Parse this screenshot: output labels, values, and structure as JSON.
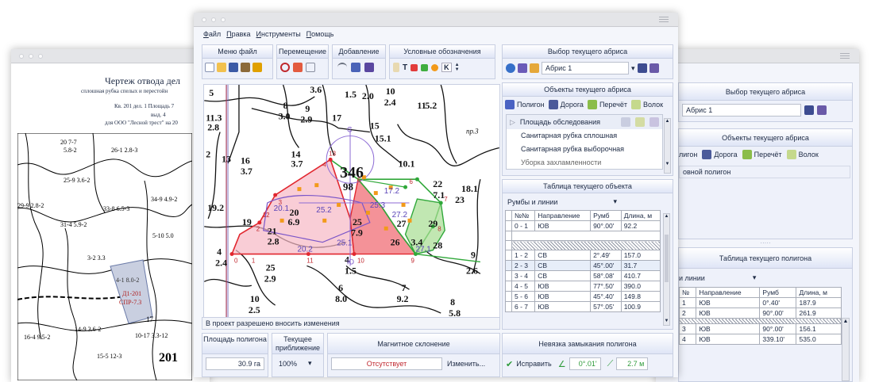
{
  "left_doc": {
    "title": "Чертеж отвода дел",
    "subtitle": "сплошная рубка спелых и перестойн",
    "line3": "Кв. 201  дел. 1  Площадь  7",
    "line4": "выд. 4",
    "line5": "для ООО \"Лесной трест\" на 20",
    "map_labels": [
      "20 7-7",
      "5.8-2",
      "26-1 2.8-3",
      "25-9 3.6-2",
      "33-8 6.5-3",
      "34-9 4.9-2",
      "29-9 2.8-2",
      "31-4 5.9-2",
      "5-10 5.0",
      "4-1 8.0-2",
      "Д1-201",
      "СПР-7.3",
      "3-2 3.3",
      "14-9 3.6-2",
      "16-4 9.5-2",
      "15-5 12-3",
      "201",
      "10-17 3.3-12",
      "17"
    ]
  },
  "main": {
    "menu": [
      {
        "label": "Файл",
        "key": "Ф",
        "rest": "айл"
      },
      {
        "label": "Правка",
        "key": "П",
        "rest": "равка"
      },
      {
        "label": "Инструменты",
        "key": "И",
        "rest": "нструменты"
      },
      {
        "label": "Помощь",
        "key": "П",
        "rest": "омощь"
      }
    ],
    "toolbar_groups": {
      "file": "Меню файл",
      "move": "Перемещение",
      "add": "Добавление",
      "legend": "Условные обозначения"
    },
    "legend_letters": {
      "t": "T",
      "k": "K"
    },
    "map": {
      "big_number": "346",
      "big_sub": "98",
      "numbers": [
        "5",
        "11.3",
        "2.8",
        "2",
        "13",
        "16",
        "3.7",
        "19.2",
        "4",
        "2.4",
        "19",
        "21",
        "2.8",
        "20",
        "6.9",
        "25",
        "7.9",
        "26",
        "3.4",
        "27",
        "28",
        "29",
        "22",
        "7.1",
        "23",
        "18.1",
        "10.1",
        "14",
        "3.7",
        "17",
        "8",
        "3.0",
        "9",
        "2.9",
        "1.5",
        "2.0",
        "10",
        "2.4",
        "11",
        "5.2",
        "15",
        "15.1",
        "пр.3",
        "4",
        "1.5",
        "2",
        "5",
        "2.9",
        "6",
        "8.0",
        "7",
        "9.2",
        "8",
        "5.8",
        "9",
        "2.6",
        "10",
        "2.5",
        "3.6"
      ],
      "distances": [
        "20.1",
        "25.2",
        "17.2",
        "25.3",
        "27.2",
        "27.1",
        "25.1",
        "20.2"
      ],
      "vertex_labels": [
        "0",
        "1",
        "2",
        "3",
        "4",
        "5",
        "6",
        "7",
        "8",
        "9",
        "10",
        "11",
        "12",
        "13"
      ],
      "compass": "С",
      "south": "Ю"
    },
    "status": "В проект разрешено вносить изменения",
    "bottom": {
      "area_label": "Площадь полигона",
      "area_value": "30.9 га",
      "zoom_label": "Текущее приближение",
      "zoom_value": "100%",
      "magnetic_label": "Магнитное склонение",
      "magnetic_value": "Отсутствует",
      "change_button": "Изменить...",
      "closure_label": "Невязка замыкания полигона",
      "fix_button": "Исправить",
      "angle_value": "0°.01'",
      "length_value": "2.7 м"
    }
  },
  "right_panel": {
    "abris_header": "Выбор текущего абриса",
    "abris_value": "Абрис 1",
    "objects_header": "Объекты текущего абриса",
    "object_buttons": [
      "Полигон",
      "Дорога",
      "Перечёт",
      "Волок"
    ],
    "objects_list": [
      "Площадь обследования",
      "Санитарная рубка сплошная",
      "Санитарная рубка выборочная",
      "Уборка захламленности"
    ],
    "table_header": "Таблица текущего объекта",
    "table_mode": "Румбы и линии",
    "columns": [
      "№№",
      "Направление",
      "Румб",
      "Длина, м"
    ],
    "rows": [
      {
        "n": "0 - 1",
        "dir": "ЮВ",
        "rumb": "90°.00'",
        "len": "92.2"
      },
      {
        "n": "1 - 2",
        "dir": "СВ",
        "rumb": "2°.49'",
        "len": "157.0"
      },
      {
        "n": "2 - 3",
        "dir": "СВ",
        "rumb": "45°.00'",
        "len": "31.7"
      },
      {
        "n": "3 - 4",
        "dir": "СВ",
        "rumb": "58°.08'",
        "len": "410.7"
      },
      {
        "n": "4 - 5",
        "dir": "ЮВ",
        "rumb": "77°.50'",
        "len": "390.0"
      },
      {
        "n": "5 - 6",
        "dir": "ЮВ",
        "rumb": "45°.40'",
        "len": "149.8"
      },
      {
        "n": "6 - 7",
        "dir": "ЮВ",
        "rumb": "57°.05'",
        "len": "100.9"
      }
    ]
  },
  "back_right": {
    "abris_header": "Выбор текущего абриса",
    "abris_value": "Абрис 1",
    "objects_header": "Объекты текущего абриса",
    "object_buttons": [
      "лигон",
      "Дорога",
      "Перечёт",
      "Волок"
    ],
    "list_item": "овной полигон",
    "table_header": "Таблица текущего полигона",
    "table_mode": "и линии",
    "columns": [
      "№",
      "Направление",
      "Румб",
      "Длина, м"
    ],
    "rows": [
      {
        "n": "1",
        "dir": "ЮВ",
        "rumb": "0°.40'",
        "len": "187.9"
      },
      {
        "n": "2",
        "dir": "ЮВ",
        "rumb": "90°.00'",
        "len": "261.9"
      },
      {
        "n": "3",
        "dir": "ЮВ",
        "rumb": "90°.00'",
        "len": "156.1"
      },
      {
        "n": "4",
        "dir": "ЮВ",
        "rumb": "339.10'",
        "len": "535.0"
      }
    ]
  }
}
